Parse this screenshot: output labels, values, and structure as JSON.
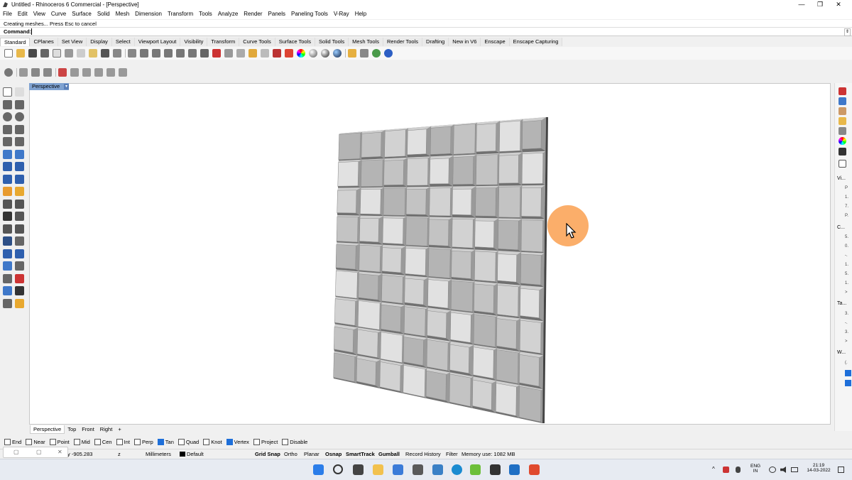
{
  "window": {
    "title": "Untitled - Rhinoceros 6 Commercial - [Perspective]",
    "minimize": "—",
    "maximize": "❐",
    "close": "✕"
  },
  "menu": [
    "File",
    "Edit",
    "View",
    "Curve",
    "Surface",
    "Solid",
    "Mesh",
    "Dimension",
    "Transform",
    "Tools",
    "Analyze",
    "Render",
    "Panels",
    "Paneling Tools",
    "V-Ray",
    "Help"
  ],
  "command": {
    "history": "Creating meshes... Press Esc to cancel",
    "label": "Command:",
    "value": ""
  },
  "tabs": [
    "Standard",
    "CPlanes",
    "Set View",
    "Display",
    "Select",
    "Viewport Layout",
    "Visibility",
    "Transform",
    "Curve Tools",
    "Surface Tools",
    "Solid Tools",
    "Mesh Tools",
    "Render Tools",
    "Drafting",
    "New in V6",
    "Enscape",
    "Enscape Capturing"
  ],
  "active_tab": "Standard",
  "viewport": {
    "title": "Perspective",
    "dropdown": "▾"
  },
  "right_panel": {
    "view_label": "Vi...",
    "camera_label": "C...",
    "target_label": "Ta...",
    "widget_label": "W...",
    "items_a": [
      "P",
      "1.",
      "7.",
      "P."
    ],
    "items_b": [
      "5.",
      "0.",
      "-.",
      "1.",
      "5.",
      "1.",
      ">"
    ],
    "items_c": [
      "3.",
      "-.",
      "3.",
      ">"
    ],
    "items_d": [
      "(."
    ]
  },
  "view_tabs": [
    "Perspective",
    "Top",
    "Front",
    "Right",
    "+"
  ],
  "osnaps": [
    {
      "label": "End",
      "checked": false
    },
    {
      "label": "Near",
      "checked": false
    },
    {
      "label": "Point",
      "checked": false
    },
    {
      "label": "Mid",
      "checked": false
    },
    {
      "label": "Cen",
      "checked": false
    },
    {
      "label": "Int",
      "checked": false
    },
    {
      "label": "Perp",
      "checked": false
    },
    {
      "label": "Tan",
      "checked": true
    },
    {
      "label": "Quad",
      "checked": false
    },
    {
      "label": "Knot",
      "checked": false
    },
    {
      "label": "Vertex",
      "checked": true
    },
    {
      "label": "Project",
      "checked": false
    },
    {
      "label": "Disable",
      "checked": false
    }
  ],
  "status": {
    "y_coord": "y -905.283",
    "z_coord": "z",
    "units": "Millimeters",
    "layer": "Default",
    "grid_snap": "Grid Snap",
    "ortho": "Ortho",
    "planar": "Planar",
    "osnap": "Osnap",
    "smarttrack": "SmartTrack",
    "gumball": "Gumball",
    "record_history": "Record History",
    "filter": "Filter",
    "memory": "Memory use: 1082 MB"
  },
  "taskbar": {
    "lang": "ENG",
    "region": "IN",
    "time": "21:19",
    "date": "14-03-2022"
  },
  "colors": {
    "viewport_title_bg": "#7fa2d1",
    "checkbox_on": "#1e6fd9",
    "cursor_highlight": "#f9a050"
  }
}
